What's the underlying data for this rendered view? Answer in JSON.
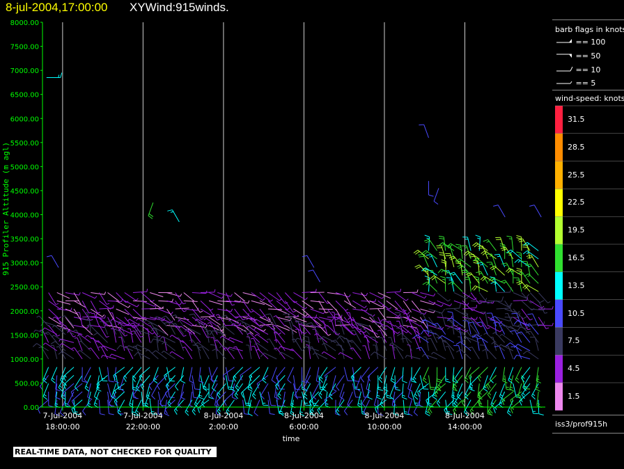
{
  "header": {
    "date_time": "8-jul-2004,17:00:00",
    "plot_title": "XYWind:915winds."
  },
  "barb_legend": {
    "title": "barb flags in knots",
    "items": [
      {
        "label": "== 100",
        "icon": "pennant-barb-icon"
      },
      {
        "label": "== 50",
        "icon": "pennant-barb-icon"
      },
      {
        "label": "== 10",
        "icon": "full-barb-icon"
      },
      {
        "label": "== 5",
        "icon": "half-barb-icon"
      }
    ]
  },
  "colorbar": {
    "title": "wind-speed: knots",
    "bins": [
      {
        "label": "31.5",
        "color": "#ff2040"
      },
      {
        "label": "28.5",
        "color": "#ff8c00"
      },
      {
        "label": "25.5",
        "color": "#ffb000"
      },
      {
        "label": "22.5",
        "color": "#ffff00"
      },
      {
        "label": "19.5",
        "color": "#b4ff30"
      },
      {
        "label": "16.5",
        "color": "#30e030"
      },
      {
        "label": "13.5",
        "color": "#00ffff"
      },
      {
        "label": "10.5",
        "color": "#4a4aff"
      },
      {
        "label": "7.5",
        "color": "#3a3a60"
      },
      {
        "label": "4.5",
        "color": "#9a20e0"
      },
      {
        "label": "1.5",
        "color": "#ee88ee"
      }
    ]
  },
  "source_id": "iss3/prof915h",
  "warning": "REAL-TIME DATA, NOT CHECKED FOR QUALITY",
  "chart_data": {
    "type": "scatter",
    "title": "XYWind:915winds.",
    "ylabel": "915 Profiler Altitude (m agl)",
    "xlabel": "time",
    "ylim": [
      0,
      8000
    ],
    "yticks": [
      "0.00",
      "500.00",
      "1000.00",
      "1500.00",
      "2000.00",
      "2500.00",
      "3000.00",
      "3500.00",
      "4000.00",
      "4500.00",
      "5000.00",
      "5500.00",
      "6000.00",
      "6500.00",
      "7000.00",
      "7500.00",
      "8000.00"
    ],
    "xticks": [
      {
        "date": "7-Jul-2004",
        "time": "18:00:00"
      },
      {
        "date": "7-Jul-2004",
        "time": "22:00:00"
      },
      {
        "date": "8-Jul-2004",
        "time": "2:00:00"
      },
      {
        "date": "8-Jul-2004",
        "time": "6:00:00"
      },
      {
        "date": "8-Jul-2004",
        "time": "10:00:00"
      },
      {
        "date": "8-Jul-2004",
        "time": "14:00:00"
      }
    ],
    "xrange_hours": [
      17,
      42
    ],
    "grid": "vertical lines at x ticks",
    "legend": "right",
    "wind_profile_layers": [
      {
        "alt_min": 150,
        "alt_max": 1000,
        "speed_kt": 12,
        "dir_deg": 200
      },
      {
        "alt_min": 1000,
        "alt_max": 1700,
        "speed_kt": 6,
        "dir_deg": 320
      },
      {
        "alt_min": 1700,
        "alt_max": 2400,
        "speed_kt": 3,
        "dir_deg": 120
      },
      {
        "alt_min": 2400,
        "alt_max": 3400,
        "speed_kt": 14,
        "dir_deg": 330
      }
    ],
    "isolated_obs": [
      {
        "hour": 17.2,
        "alt": 6850,
        "speed_kt": 13,
        "dir_deg": 90
      },
      {
        "hour": 17.8,
        "alt": 2900,
        "speed_kt": 10,
        "dir_deg": 330
      },
      {
        "hour": 22.5,
        "alt": 4250,
        "speed_kt": 18,
        "dir_deg": 200
      },
      {
        "hour": 23.8,
        "alt": 3850,
        "speed_kt": 14,
        "dir_deg": 330
      },
      {
        "hour": 30.5,
        "alt": 2900,
        "speed_kt": 10,
        "dir_deg": 330
      },
      {
        "hour": 30.8,
        "alt": 2600,
        "speed_kt": 10,
        "dir_deg": 330
      },
      {
        "hour": 36.2,
        "alt": 5600,
        "speed_kt": 10,
        "dir_deg": 340
      },
      {
        "hour": 36.2,
        "alt": 4700,
        "speed_kt": 10,
        "dir_deg": 180
      },
      {
        "hour": 36.7,
        "alt": 4550,
        "speed_kt": 10,
        "dir_deg": 200
      },
      {
        "hour": 40.0,
        "alt": 3950,
        "speed_kt": 10,
        "dir_deg": 330
      },
      {
        "hour": 41.8,
        "alt": 3950,
        "speed_kt": 10,
        "dir_deg": 330
      }
    ]
  }
}
